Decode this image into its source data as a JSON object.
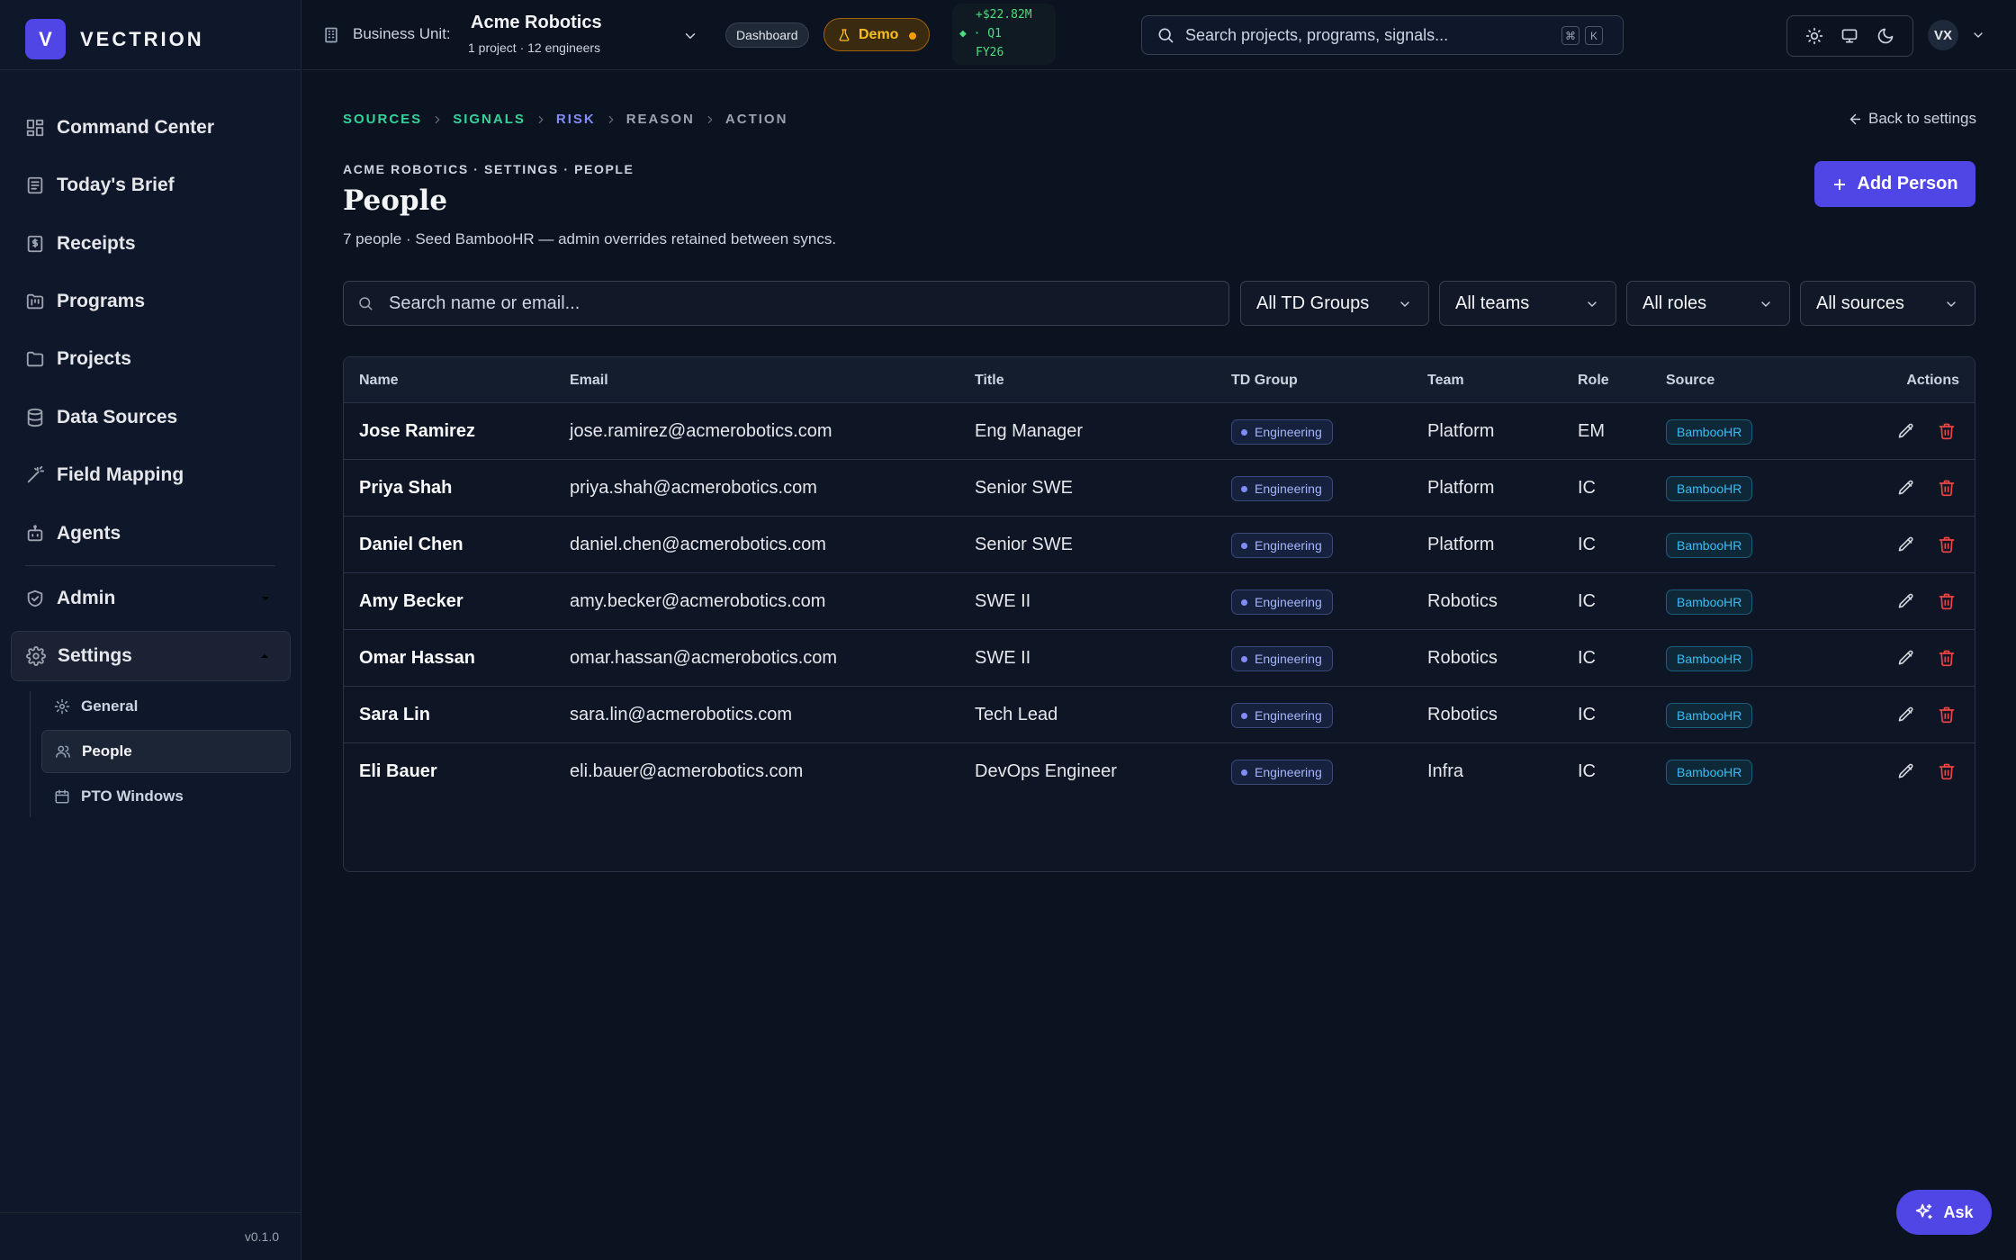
{
  "brand": {
    "mark": "V",
    "name": "VECTRION",
    "version": "v0.1.0"
  },
  "sidebar": {
    "items": [
      {
        "label": "Command Center",
        "icon": "layout-dashboard-icon"
      },
      {
        "label": "Today's Brief",
        "icon": "newspaper-icon"
      },
      {
        "label": "Receipts",
        "icon": "receipt-icon"
      },
      {
        "label": "Programs",
        "icon": "folder-kanban-icon"
      },
      {
        "label": "Projects",
        "icon": "folder-icon"
      },
      {
        "label": "Data Sources",
        "icon": "database-icon"
      },
      {
        "label": "Field Mapping",
        "icon": "wand-icon"
      },
      {
        "label": "Agents",
        "icon": "bot-icon"
      }
    ],
    "admin": {
      "label": "Admin",
      "icon": "shield-check-icon"
    },
    "settings": {
      "label": "Settings",
      "icon": "gear-icon",
      "children": [
        {
          "label": "General",
          "icon": "gear-icon"
        },
        {
          "label": "People",
          "icon": "users-icon"
        },
        {
          "label": "PTO Windows",
          "icon": "calendar-icon"
        }
      ]
    }
  },
  "topbar": {
    "bu_label": "Business Unit:",
    "bu_name": "Acme Robotics",
    "bu_meta": "1 project · 12 engineers",
    "dashboard": "Dashboard",
    "demo": "Demo",
    "ticker": {
      "l1": "+$22.82M",
      "l2": "◆ · Q1",
      "l3": "FY26"
    },
    "search_placeholder": "Search projects, programs, signals...",
    "kbd1": "⌘",
    "kbd2": "K",
    "avatar": "VX"
  },
  "pipeline": {
    "steps": [
      {
        "label": "SOURCES",
        "color": "#34d399"
      },
      {
        "label": "SIGNALS",
        "color": "#34d399"
      },
      {
        "label": "RISK",
        "color": "#818cf8"
      },
      {
        "label": "REASON",
        "color": "#9ca3af"
      },
      {
        "label": "ACTION",
        "color": "#9ca3af"
      }
    ]
  },
  "page": {
    "back": "Back to settings",
    "crumb": "ACME ROBOTICS · SETTINGS · PEOPLE",
    "title": "People",
    "subtitle": "7 people · Seed BambooHR — admin overrides retained between syncs.",
    "add_button": "Add Person"
  },
  "filters": {
    "search_placeholder": "Search name or email...",
    "td_groups": "All TD Groups",
    "teams": "All teams",
    "roles": "All roles",
    "sources": "All sources"
  },
  "table": {
    "columns": [
      "Name",
      "Email",
      "Title",
      "TD Group",
      "Team",
      "Role",
      "Source",
      "Actions"
    ],
    "rows": [
      {
        "name": "Jose Ramirez",
        "email": "jose.ramirez@acmerobotics.com",
        "title": "Eng Manager",
        "td_group": "Engineering",
        "team": "Platform",
        "role": "EM",
        "source": "BambooHR"
      },
      {
        "name": "Priya Shah",
        "email": "priya.shah@acmerobotics.com",
        "title": "Senior SWE",
        "td_group": "Engineering",
        "team": "Platform",
        "role": "IC",
        "source": "BambooHR"
      },
      {
        "name": "Daniel Chen",
        "email": "daniel.chen@acmerobotics.com",
        "title": "Senior SWE",
        "td_group": "Engineering",
        "team": "Platform",
        "role": "IC",
        "source": "BambooHR"
      },
      {
        "name": "Amy Becker",
        "email": "amy.becker@acmerobotics.com",
        "title": "SWE II",
        "td_group": "Engineering",
        "team": "Robotics",
        "role": "IC",
        "source": "BambooHR"
      },
      {
        "name": "Omar Hassan",
        "email": "omar.hassan@acmerobotics.com",
        "title": "SWE II",
        "td_group": "Engineering",
        "team": "Robotics",
        "role": "IC",
        "source": "BambooHR"
      },
      {
        "name": "Sara Lin",
        "email": "sara.lin@acmerobotics.com",
        "title": "Tech Lead",
        "td_group": "Engineering",
        "team": "Robotics",
        "role": "IC",
        "source": "BambooHR"
      },
      {
        "name": "Eli Bauer",
        "email": "eli.bauer@acmerobotics.com",
        "title": "DevOps Engineer",
        "td_group": "Engineering",
        "team": "Infra",
        "role": "IC",
        "source": "BambooHR"
      }
    ]
  },
  "ask_button": "Ask",
  "colors": {
    "accent": "#4f46e5",
    "danger": "#ef4444",
    "demo": "#fbbf24",
    "ticker": "#4ade80"
  }
}
